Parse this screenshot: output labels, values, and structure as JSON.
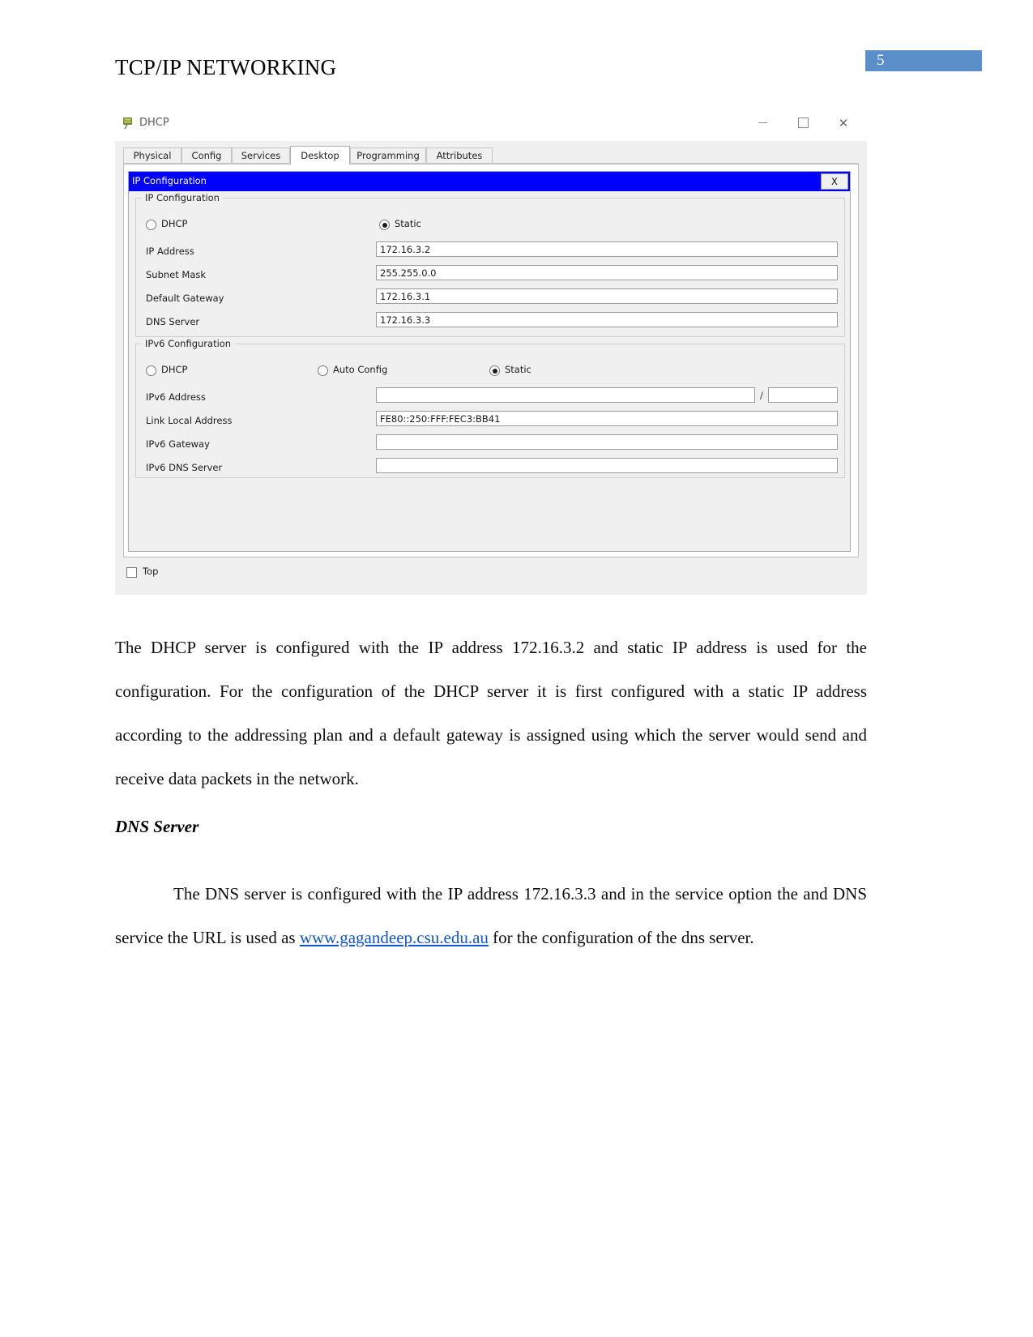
{
  "header": {
    "title": "TCP/IP NETWORKING",
    "page_number": "5",
    "badge_color": "#5b8fc9"
  },
  "screenshot": {
    "window": {
      "title": "DHCP",
      "icon": "packet-tracer-server-icon",
      "controls": {
        "minimize": "–",
        "maximize": "□",
        "close": "✕"
      }
    },
    "tabs": [
      {
        "label": "Physical",
        "active": false
      },
      {
        "label": "Config",
        "active": false
      },
      {
        "label": "Services",
        "active": false
      },
      {
        "label": "Desktop",
        "active": true
      },
      {
        "label": "Programming",
        "active": false
      },
      {
        "label": "Attributes",
        "active": false
      }
    ],
    "dialog": {
      "titlebar_text": "IP Configuration",
      "titlebar_color": "#0000ff",
      "close_label": "X",
      "ipv4": {
        "legend": "IP Configuration",
        "mode_options": [
          {
            "label": "DHCP",
            "selected": false
          },
          {
            "label": "Static",
            "selected": true
          }
        ],
        "fields": [
          {
            "label": "IP Address",
            "value": "172.16.3.2"
          },
          {
            "label": "Subnet Mask",
            "value": "255.255.0.0"
          },
          {
            "label": "Default Gateway",
            "value": "172.16.3.1"
          },
          {
            "label": "DNS Server",
            "value": "172.16.3.3"
          }
        ]
      },
      "ipv6": {
        "legend": "IPv6 Configuration",
        "mode_options": [
          {
            "label": "DHCP",
            "selected": false
          },
          {
            "label": "Auto Config",
            "selected": false
          },
          {
            "label": "Static",
            "selected": true
          }
        ],
        "address_label": "IPv6 Address",
        "address_value": "",
        "prefix_separator": "/",
        "prefix_value": "",
        "fields": [
          {
            "label": "Link Local Address",
            "value": "FE80::250:FFF:FEC3:BB41"
          },
          {
            "label": "IPv6 Gateway",
            "value": ""
          },
          {
            "label": "IPv6 DNS Server",
            "value": ""
          }
        ]
      }
    },
    "bottom": {
      "top_checkbox_label": "Top",
      "top_checkbox_checked": false
    }
  },
  "body": {
    "paragraph_1": "The DHCP server is configured with the IP address 172.16.3.2 and static IP address is used for the configuration. For the configuration of the DHCP server it is first configured with a static IP address according to the addressing plan and a default gateway is assigned using which the server would send and receive data packets in the network.",
    "heading_dns": "DNS Server",
    "paragraph_2_before_link": "The DNS server is configured with the IP address 172.16.3.3 and in the service option the and DNS service the URL is used as ",
    "paragraph_2_link": "www.gagandeep.csu.edu.au",
    "paragraph_2_after_link": " for the configuration of the dns server."
  }
}
